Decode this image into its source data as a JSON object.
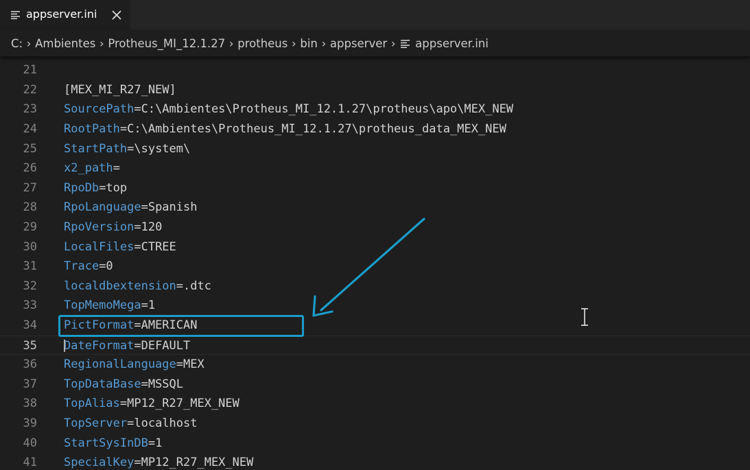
{
  "tab": {
    "label": "appserver.ini",
    "file_icon": "lines-file-icon",
    "close_icon": "close-icon"
  },
  "breadcrumb": {
    "items": [
      "C:",
      "Ambientes",
      "Protheus_MI_12.1.27",
      "protheus",
      "bin",
      "appserver"
    ],
    "file": "appserver.ini",
    "separator_icon": "chevron-right-icon"
  },
  "colors": {
    "key": "#569cd6",
    "value": "#d4d4d4",
    "line_number": "#858585",
    "annotation": "#1a9cc9",
    "background": "#1e1e1e"
  },
  "editor": {
    "current_line": "35",
    "lines": [
      {
        "n": "21",
        "key": "",
        "rest": ""
      },
      {
        "n": "22",
        "key": "",
        "rest": "[MEX_MI_R27_NEW]"
      },
      {
        "n": "23",
        "key": "SourcePath",
        "rest": "=C:\\Ambientes\\Protheus_MI_12.1.27\\protheus\\apo\\MEX_NEW"
      },
      {
        "n": "24",
        "key": "RootPath",
        "rest": "=C:\\Ambientes\\Protheus_MI_12.1.27\\protheus_data_MEX_NEW"
      },
      {
        "n": "25",
        "key": "StartPath",
        "rest": "=\\system\\"
      },
      {
        "n": "26",
        "key": "x2_path",
        "rest": "="
      },
      {
        "n": "27",
        "key": "RpoDb",
        "rest": "=top"
      },
      {
        "n": "28",
        "key": "RpoLanguage",
        "rest": "=Spanish"
      },
      {
        "n": "29",
        "key": "RpoVersion",
        "rest": "=120"
      },
      {
        "n": "30",
        "key": "LocalFiles",
        "rest": "=CTREE"
      },
      {
        "n": "31",
        "key": "Trace",
        "rest": "=0"
      },
      {
        "n": "32",
        "key": "localdbextension",
        "rest": "=.dtc"
      },
      {
        "n": "33",
        "key": "TopMemoMega",
        "rest": "=1"
      },
      {
        "n": "34",
        "key": "PictFormat",
        "rest": "=AMERICAN"
      },
      {
        "n": "35",
        "key": "DateFormat",
        "rest": "=DEFAULT"
      },
      {
        "n": "36",
        "key": "RegionalLanguage",
        "rest": "=MEX"
      },
      {
        "n": "37",
        "key": "TopDataBase",
        "rest": "=MSSQL"
      },
      {
        "n": "38",
        "key": "TopAlias",
        "rest": "=MP12_R27_MEX_NEW"
      },
      {
        "n": "39",
        "key": "TopServer",
        "rest": "=localhost"
      },
      {
        "n": "40",
        "key": "StartSysInDB",
        "rest": "=1"
      },
      {
        "n": "41",
        "key": "SpecialKey",
        "rest": "=MP12_R27_MEX_NEW"
      }
    ]
  }
}
